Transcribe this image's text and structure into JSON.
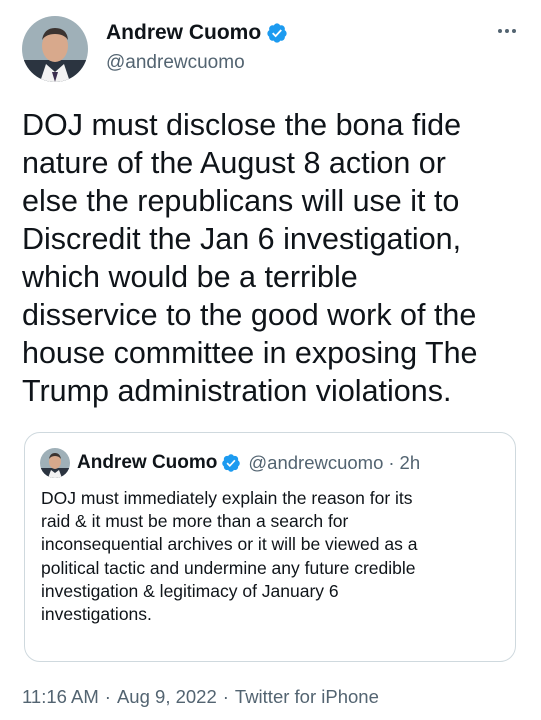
{
  "author": {
    "display_name": "Andrew Cuomo",
    "handle": "@andrewcuomo",
    "avatar_icon": "profile-photo",
    "verified_icon": "verified-badge-icon",
    "verified_color": "#1d9bf0"
  },
  "menu": {
    "icon": "more-options-icon"
  },
  "tweet": {
    "text": "DOJ must disclose the bona fide\nnature of the August 8 action or\nelse the republicans will use it to\nDiscredit the Jan 6 investigation,\nwhich would be a terrible\ndisservice to the good work of the\nhouse committee in exposing The\nTrump administration violations."
  },
  "quoted_tweet": {
    "display_name": "Andrew Cuomo",
    "handle": "@andrewcuomo",
    "separator": "·",
    "time_ago": "2h",
    "text": "DOJ must immediately explain the reason for its\nraid & it must be more than a search for\ninconsequential archives or it will be viewed as a\npolitical tactic and undermine any future credible\ninvestigation & legitimacy of January 6\ninvestigations."
  },
  "meta": {
    "time": "11:16 AM",
    "separator": "·",
    "date": "Aug 9, 2022",
    "source": "Twitter for iPhone"
  },
  "colors": {
    "text_primary": "#0f1419",
    "text_secondary": "#536471",
    "border": "#cfd9de"
  }
}
